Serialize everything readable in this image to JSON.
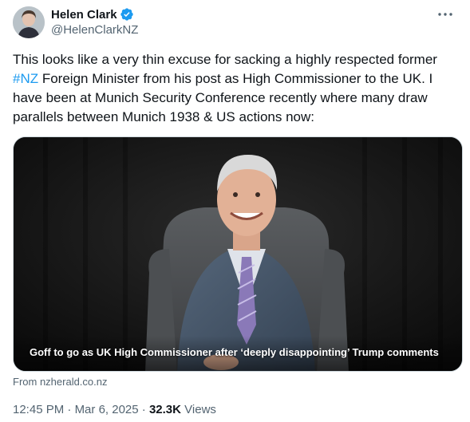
{
  "author": {
    "name": "Helen Clark",
    "handle": "@HelenClarkNZ",
    "verified_color": "#1d9bf0"
  },
  "icons": {
    "more": "more-horizontal-icon",
    "verified": "verified-badge-icon"
  },
  "tweet": {
    "text_before_tag": "This looks like a very thin excuse for sacking a highly respected former ",
    "hashtag": "#NZ",
    "text_after_tag": " Foreign Minister from his post as High Commissioner to the UK. I have been at Munich Security Conference recently where many draw parallels between Munich 1938 & US actions now:"
  },
  "link_card": {
    "title": "Goff to go as UK High Commissioner after ‘deeply disappointing’ Trump comments",
    "source": "From nzherald.co.nz"
  },
  "meta": {
    "time": "12:45 PM",
    "separator1": "·",
    "date": "Mar 6, 2025",
    "separator2": "·",
    "views_count": "32.3K",
    "views_label": "Views"
  },
  "colors": {
    "text": "#0f1419",
    "secondary": "#536471",
    "link": "#1d9bf0"
  }
}
